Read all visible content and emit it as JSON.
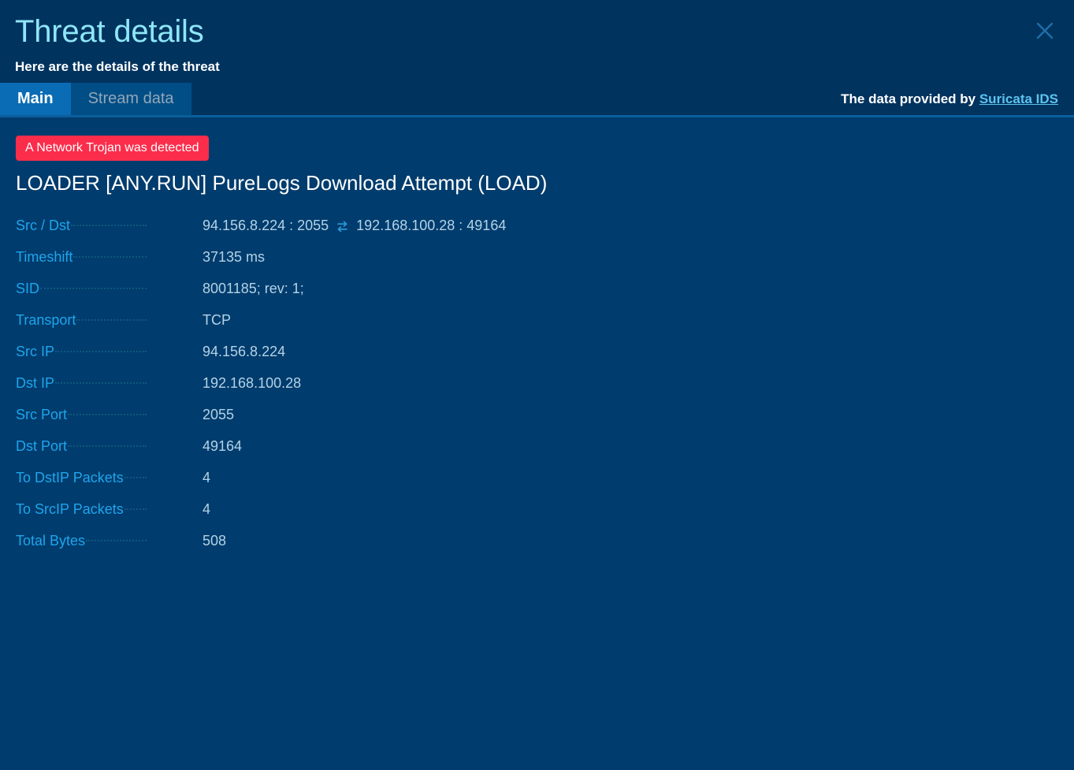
{
  "header": {
    "title": "Threat details",
    "subtitle": "Here are the details of the threat",
    "close_icon": "close-icon"
  },
  "tabs": [
    {
      "label": "Main",
      "active": true
    },
    {
      "label": "Stream data",
      "active": false
    }
  ],
  "provider": {
    "prefix": "The data provided by ",
    "link_label": "Suricata IDS"
  },
  "threat": {
    "badge": "A Network Trojan was detected",
    "name": "LOADER [ANY.RUN] PureLogs Download Attempt (LOAD)"
  },
  "details": [
    {
      "label": "Src / Dst",
      "value": "94.156.8.224 : 2055",
      "value2": "192.168.100.28 : 49164",
      "icon": "swap-arrows-icon"
    },
    {
      "label": "Timeshift",
      "value": "37135 ms"
    },
    {
      "label": "SID",
      "value": "8001185; rev: 1;"
    },
    {
      "label": "Transport",
      "value": "TCP"
    },
    {
      "label": "Src IP",
      "value": "94.156.8.224"
    },
    {
      "label": "Dst IP",
      "value": "192.168.100.28"
    },
    {
      "label": "Src Port",
      "value": "2055"
    },
    {
      "label": "Dst Port",
      "value": "49164"
    },
    {
      "label": "To DstIP Packets",
      "value": "4"
    },
    {
      "label": "To SrcIP Packets",
      "value": "4"
    },
    {
      "label": "Total Bytes",
      "value": "508"
    }
  ],
  "colors": {
    "background": "#003c6d",
    "header_background": "#00335e",
    "title": "#8fe6f7",
    "accent_tab": "#0a6cb4",
    "badge_red": "#fb2d4b",
    "label": "#1fa5ec",
    "value": "#b3d3e8",
    "link": "#5cc3ef"
  }
}
